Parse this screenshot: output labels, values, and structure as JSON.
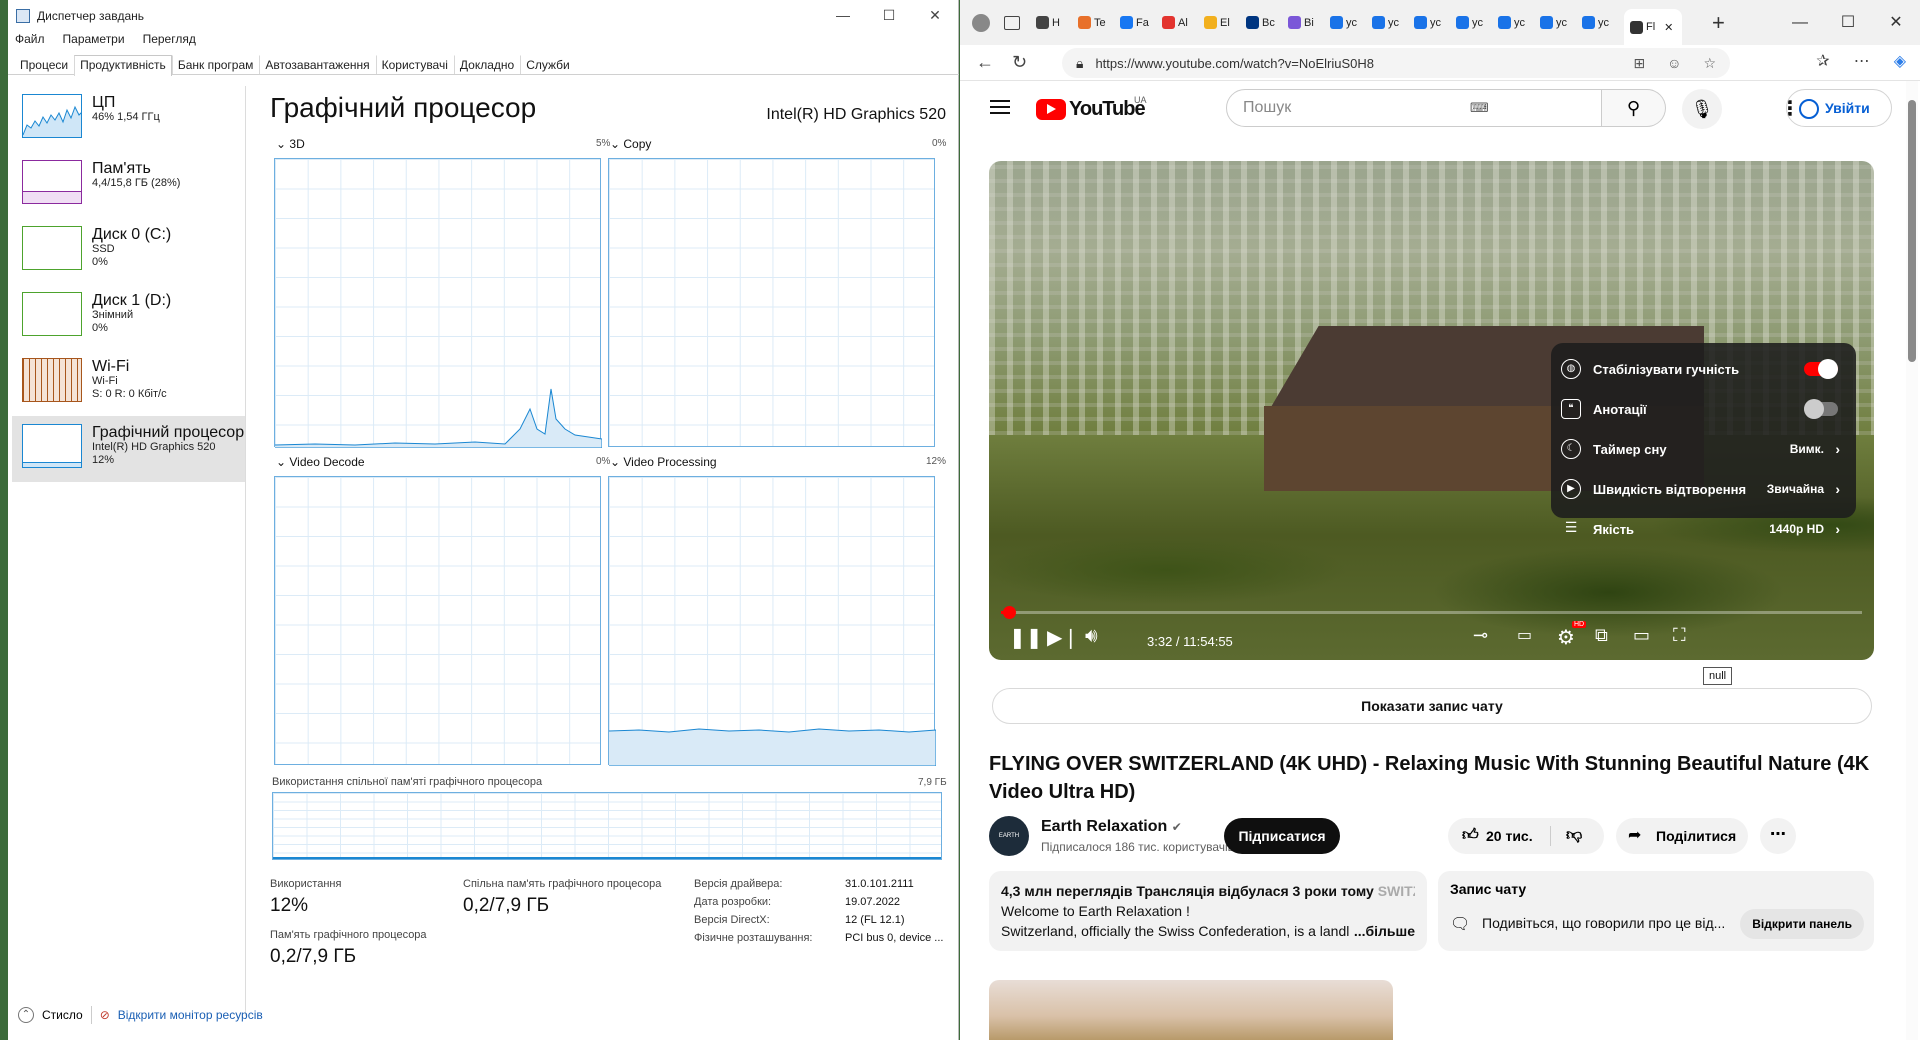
{
  "taskmgr": {
    "title": "Диспетчер завдань",
    "window_buttons": [
      "—",
      "☐",
      "✕"
    ],
    "menu": [
      "Файл",
      "Параметри",
      "Перегляд"
    ],
    "tabs": [
      "Процеси",
      "Продуктивність",
      "Банк програм",
      "Автозавантаження",
      "Користувачі",
      "Докладно",
      "Служби"
    ],
    "active_tab": "Продуктивність",
    "sidebar": [
      {
        "name": "ЦП",
        "sub1": "46% 1,54 ГГц",
        "sub2": "",
        "sub3": "",
        "color": "#1a87d2"
      },
      {
        "name": "Пам'ять",
        "sub1": "4,4/15,8 ГБ (28%)",
        "sub2": "",
        "sub3": "",
        "color": "#8b2a9e"
      },
      {
        "name": "Диск 0 (C:)",
        "sub1": "SSD",
        "sub2": "0%",
        "sub3": "",
        "color": "#4da32d"
      },
      {
        "name": "Диск 1 (D:)",
        "sub1": "Знімний",
        "sub2": "0%",
        "sub3": "",
        "color": "#4da32d"
      },
      {
        "name": "Wi-Fi",
        "sub1": "Wi-Fi",
        "sub2": "S: 0 R: 0 Кбіт/с",
        "sub3": "",
        "color": "#a7561c"
      },
      {
        "name": "Графічний процесор",
        "sub1": "Intel(R) HD Graphics 520",
        "sub2": "12%",
        "sub3": "",
        "color": "#1a87d2"
      }
    ],
    "gpu": {
      "title": "Графічний процесор",
      "model": "Intel(R) HD Graphics 520",
      "engines": [
        {
          "label": "3D",
          "pct": "5%"
        },
        {
          "label": "Copy",
          "pct": "0%"
        },
        {
          "label": "Video Decode",
          "pct": "0%"
        },
        {
          "label": "Video Processing",
          "pct": "12%"
        }
      ],
      "shared_label": "Використання спільної пам'яті графічного процесора",
      "shared_max": "7,9 ГБ",
      "usage_label": "Використання",
      "usage_value": "12%",
      "shared_mem_label": "Спільна пам'ять графічного процесора",
      "shared_mem_value": "0,2/7,9 ГБ",
      "gpu_mem_label": "Пам'ять графічного процесора",
      "gpu_mem_value": "0,2/7,9 ГБ",
      "info": [
        {
          "k": "Версія драйвера:",
          "v": "31.0.101.2111"
        },
        {
          "k": "Дата розробки:",
          "v": "19.07.2022"
        },
        {
          "k": "Версія DirectX:",
          "v": "12 (FL 12.1)"
        },
        {
          "k": "Фізичне розташування:",
          "v": "PCI bus 0, device ..."
        }
      ]
    },
    "footer": {
      "less": "Стисло",
      "monitor": "Відкрити монітор ресурсів"
    }
  },
  "browser": {
    "tabs": [
      {
        "label": "H",
        "color": "#444"
      },
      {
        "label": "Te",
        "color": "#e8702a"
      },
      {
        "label": "Fa",
        "color": "#1877f2"
      },
      {
        "label": "Al",
        "color": "#e3342f"
      },
      {
        "label": "El",
        "color": "#f2b01e"
      },
      {
        "label": "Bc",
        "color": "#003580"
      },
      {
        "label": "Bi",
        "color": "#7b57d8"
      },
      {
        "label": "yc",
        "color": "#1a73e8"
      },
      {
        "label": "yc",
        "color": "#1a73e8"
      },
      {
        "label": "yc",
        "color": "#1a73e8"
      },
      {
        "label": "yc",
        "color": "#1a73e8"
      },
      {
        "label": "yc",
        "color": "#1a73e8"
      },
      {
        "label": "yc",
        "color": "#1a73e8"
      },
      {
        "label": "yc",
        "color": "#1a73e8"
      }
    ],
    "active_tab_label": "Fl",
    "url": "https://www.youtube.com/watch?v=NoElriuS0H8",
    "window_buttons": [
      "—",
      "☐",
      "✕"
    ]
  },
  "youtube": {
    "logo": "YouTube",
    "region": "UA",
    "search_placeholder": "Пошук",
    "login": "Увійти",
    "settings": [
      {
        "label": "Стабілізувати гучність",
        "value": "",
        "toggle": "on"
      },
      {
        "label": "Анотації",
        "value": "",
        "toggle": "off"
      },
      {
        "label": "Таймер сну",
        "value": "Вимк.",
        "toggle": ""
      },
      {
        "label": "Швидкість відтворення",
        "value": "Звичайна",
        "toggle": ""
      },
      {
        "label": "Якість",
        "value": "1440p HD",
        "toggle": ""
      }
    ],
    "time": "3:32 / 11:54:55",
    "progress_fraction": 0.005,
    "hd_badge": "HD",
    "tooltip": "null",
    "chat_replay": "Показати запис чату",
    "video_title": "FLYING OVER SWITZERLAND (4K UHD) - Relaxing Music With Stunning Beautiful Nature (4K Video Ultra HD)",
    "channel": "Earth Relaxation",
    "subscribers": "Підписалося 186 тис. користувачів",
    "subscribe": "Підписатися",
    "likes": "20 тис.",
    "share": "Поділитися",
    "desc_meta": "4,3 млн переглядів  Трансляція відбулася 3 роки тому",
    "desc_meta_fade": "SWITZ",
    "desc_line1": "Welcome to Earth Relaxation !",
    "desc_line2": "Switzerland, officially the Swiss Confederation, is a landl",
    "desc_more": "...більше",
    "chat_title": "Запис чату",
    "chat_desc": "Подивіться, що говорили про це від...",
    "chat_open": "Відкрити панель",
    "avatar_text": "EARTH RELAXATION"
  }
}
